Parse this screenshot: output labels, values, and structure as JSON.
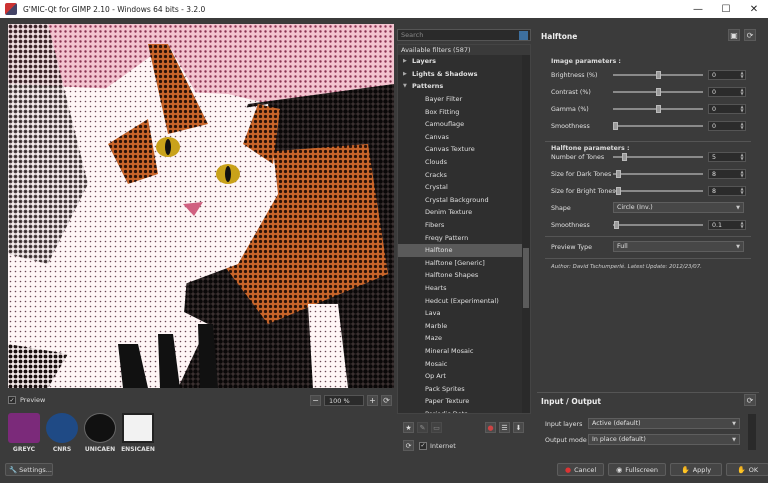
{
  "window": {
    "title": "G'MIC-Qt for GIMP 2.10 - Windows 64 bits - 3.2.0",
    "minimize": "—",
    "maximize": "☐",
    "close": "✕"
  },
  "preview": {
    "checkbox_label": "Preview",
    "checked": true,
    "zoom": "100 %"
  },
  "logos": [
    {
      "label": "GREYC",
      "color": "#7b2a7a"
    },
    {
      "label": "CNRS",
      "color": "#1f4a85"
    },
    {
      "label": "UNICAEN",
      "color": "#111111"
    },
    {
      "label": "ENSICAEN",
      "color": "#222222"
    }
  ],
  "settings_button": "Settings...",
  "filters": {
    "search_placeholder": "Search",
    "header": "Available filters (587)",
    "folders_before": [
      "Layers",
      "Lights & Shadows",
      "Patterns"
    ],
    "items": [
      "Bayer Filter",
      "Box Fitting",
      "Camouflage",
      "Canvas",
      "Canvas Texture",
      "Clouds",
      "Cracks",
      "Crystal",
      "Crystal Background",
      "Denim Texture",
      "Fibers",
      "Freqy Pattern",
      "Halftone",
      "Halftone [Generic]",
      "Halftone Shapes",
      "Hearts",
      "Hedcut (Experimental)",
      "Lava",
      "Marble",
      "Maze",
      "Mineral Mosaic",
      "Mosaic",
      "Op Art",
      "Pack Sprites",
      "Paper Texture",
      "Periodic Dots"
    ],
    "selected": "Halftone",
    "internet_label": "Internet"
  },
  "params": {
    "filter_name": "Halftone",
    "image_section": "Image parameters :",
    "image_params": [
      {
        "label": "Brightness (%)",
        "value": "0",
        "pos": 0.5
      },
      {
        "label": "Contrast (%)",
        "value": "0",
        "pos": 0.5
      },
      {
        "label": "Gamma (%)",
        "value": "0",
        "pos": 0.5
      },
      {
        "label": "Smoothness",
        "value": "0",
        "pos": 0.0
      }
    ],
    "halftone_section": "Halftone parameters :",
    "halftone_params": [
      {
        "label": "Number of Tones",
        "value": "5",
        "pos": 0.1
      },
      {
        "label": "Size for Dark Tones",
        "value": "8",
        "pos": 0.03
      },
      {
        "label": "Size for Bright Tones",
        "value": "8",
        "pos": 0.03
      }
    ],
    "shape_label": "Shape",
    "shape_value": "Circle (Inv.)",
    "smoothness2_label": "Smoothness",
    "smoothness2_value": "0.1",
    "smoothness2_pos": 0.01,
    "preview_type_label": "Preview Type",
    "preview_type_value": "Full",
    "author": "Author: David Tschumperlé.      Latest Update: 2012/23/07."
  },
  "io": {
    "title": "Input / Output",
    "input_label": "Input layers",
    "input_value": "Active (default)",
    "output_label": "Output mode",
    "output_value": "In place (default)"
  },
  "buttons": {
    "cancel": "Cancel",
    "fullscreen": "Fullscreen",
    "apply": "Apply",
    "ok": "OK"
  }
}
